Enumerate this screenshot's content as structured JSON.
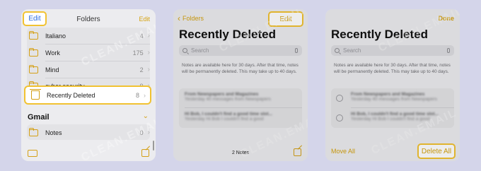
{
  "watermark": "CLEAN.EMAIL",
  "colors": {
    "accent": "#d4a017",
    "highlight_border": "#f1c232",
    "background": "#d4d5ea"
  },
  "panel1": {
    "edit_left": "Edit",
    "title": "Folders",
    "edit_right": "Edit",
    "folders": [
      {
        "name": "Italiano",
        "count": "4",
        "icon": "folder-icon"
      },
      {
        "name": "Work",
        "count": "175",
        "icon": "folder-icon"
      },
      {
        "name": "Mind",
        "count": "2",
        "icon": "folder-icon"
      },
      {
        "name": "cyber security",
        "count": "9",
        "icon": "folder-icon"
      }
    ],
    "recently_deleted": {
      "name": "Recently Deleted",
      "count": "8",
      "icon": "trash-icon"
    },
    "gmail_section": "Gmail",
    "gmail_folders": [
      {
        "name": "Notes",
        "count": "0",
        "icon": "folder-icon"
      }
    ],
    "chevron": "›"
  },
  "panel2": {
    "back_label": "Folders",
    "edit": "Edit",
    "title": "Recently Deleted",
    "search_placeholder": "Search",
    "notice": "Notes are available here for 30 days. After that time, notes will be permanently deleted. This may take up to 40 days.",
    "notes": [
      {
        "title": "From Newspapers and Magazines",
        "snippet": "Yesterday  40 messages from Newspapers"
      },
      {
        "title": "Hi Bob, I couldn't find a good time slot...",
        "snippet": "Yesterday  Hi Bob I couldn't find a good"
      }
    ],
    "notes_count": "2 Notes"
  },
  "panel3": {
    "done": "Done",
    "title": "Recently Deleted",
    "search_placeholder": "Search",
    "notice": "Notes are available here for 30 days. After that time, notes will be permanently deleted. This may take up to 40 days.",
    "notes": [
      {
        "title": "From Newspapers and Magazines",
        "snippet": "Yesterday  40 messages from Newspapers"
      },
      {
        "title": "Hi Bob, I couldn't find a good time slot...",
        "snippet": "Yesterday  Hi Bob I couldn't find a good"
      }
    ],
    "move_all": "Move All",
    "delete_all": "Delete All"
  }
}
